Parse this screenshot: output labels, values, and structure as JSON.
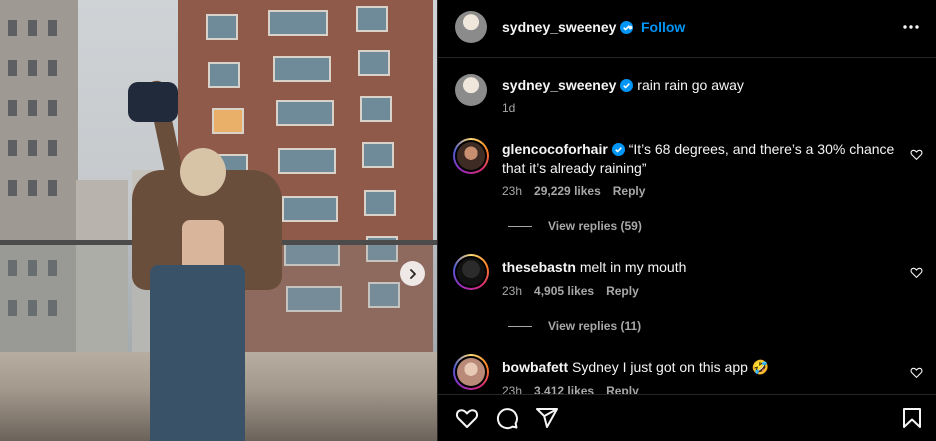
{
  "header": {
    "username": "sydney_sweeney",
    "separator": "•",
    "follow_label": "Follow"
  },
  "caption": {
    "username": "sydney_sweeney",
    "text": "rain rain go away",
    "time": "1d"
  },
  "comments": [
    {
      "username": "glencocoforhair",
      "verified": true,
      "text": "“It’s 68 degrees, and there’s a 30% chance that it’s already raining”",
      "time": "23h",
      "likes": "29,229 likes",
      "reply_label": "Reply",
      "view_replies": "View replies (59)"
    },
    {
      "username": "thesebastn",
      "verified": false,
      "text": "melt in my mouth",
      "time": "23h",
      "likes": "4,905 likes",
      "reply_label": "Reply",
      "view_replies": "View replies (11)"
    },
    {
      "username": "bowbafett",
      "verified": false,
      "text": "Sydney I just got on this app 🤣",
      "time": "23h",
      "likes": "3,412 likes",
      "reply_label": "Reply"
    }
  ],
  "icons": {
    "verified": "verified-badge-icon",
    "more": "more-options-icon",
    "like": "heart-icon",
    "comment": "comment-icon",
    "share": "share-icon",
    "save": "bookmark-icon",
    "next": "chevron-right-icon"
  },
  "colors": {
    "background": "#000000",
    "follow": "#0095f6",
    "verified": "#0095f6",
    "secondary_text": "#a8a8a8"
  }
}
